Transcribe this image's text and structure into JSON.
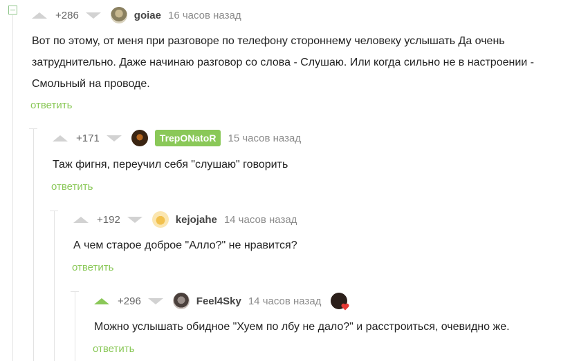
{
  "colors": {
    "accent": "#8ac858",
    "muted": "#8b8b8b",
    "vote": "#d2d2d2"
  },
  "comments": [
    {
      "rating": "+286",
      "username": "goiae",
      "time": "16 часов назад",
      "text": "Вот по этому, от меня при разговоре по телефону стороннему человеку услышать Да очень затруднительно. Даже начинаю разговор со слова - Слушаю. Или когда сильно не в настроении - Смольный на проводе.",
      "reply": "ответить"
    },
    {
      "rating": "+171",
      "username": "TrepONatoR",
      "time": "15 часов назад",
      "text": "Таж фигня, переучил себя \"слушаю\" говорить",
      "reply": "ответить"
    },
    {
      "rating": "+192",
      "username": "kejojahe",
      "time": "14 часов назад",
      "text": "А чем старое доброе \"Алло?\" не нравится?",
      "reply": "ответить"
    },
    {
      "rating": "+296",
      "username": "Feel4Sky",
      "time": "14 часов назад",
      "text": "Можно услышать обидное \"Хуем по лбу не дало?\" и расстроиться, очевидно же.",
      "reply": "ответить"
    }
  ]
}
